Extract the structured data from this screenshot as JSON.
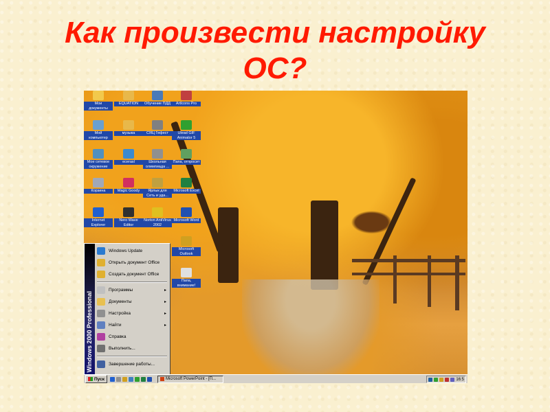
{
  "slide": {
    "title_line1": "Как произвести настройку",
    "title_line2": "ОС?"
  },
  "desktop_icons": [
    {
      "label": "Мои документы",
      "icon": "folder-docs-icon",
      "color": "#f2c94c"
    },
    {
      "label": "EQUATION",
      "icon": "folder-icon",
      "color": "#e8b84a"
    },
    {
      "label": "Обучение ПДД",
      "icon": "car-icon",
      "color": "#4a7ab8"
    },
    {
      "label": "ArtIcons Pro",
      "icon": "app-icon",
      "color": "#c04040"
    },
    {
      "label": "Мой компьютер",
      "icon": "computer-icon",
      "color": "#6aa0d0"
    },
    {
      "label": "музыка",
      "icon": "folder-icon",
      "color": "#e8b84a"
    },
    {
      "label": "СЯЦ Гефест",
      "icon": "app-icon",
      "color": "#808080"
    },
    {
      "label": "Ulead GIF Animator 5",
      "icon": "app-icon",
      "color": "#30a030"
    },
    {
      "label": "Мое сетевое окружение",
      "icon": "network-icon",
      "color": "#5090c0"
    },
    {
      "label": "ecerasl",
      "icon": "app-icon",
      "color": "#3a8ad0"
    },
    {
      "label": "Школьная олимпиада ...",
      "icon": "app-icon",
      "color": "#909090"
    },
    {
      "label": "Папа, отпросит",
      "icon": "app-icon",
      "color": "#60a060"
    },
    {
      "label": "Корзина",
      "icon": "recycle-bin-icon",
      "color": "#a0a8b8"
    },
    {
      "label": "Magic Goody",
      "icon": "app-icon",
      "color": "#d03060"
    },
    {
      "label": "Ярлык для Сеть и уда...",
      "icon": "network-icon",
      "color": "#c0a040"
    },
    {
      "label": "Microsoft Excel",
      "icon": "excel-icon",
      "color": "#208040"
    },
    {
      "label": "Internet Explorer",
      "icon": "ie-icon",
      "color": "#2060d0"
    },
    {
      "label": "Nero Wave Editor",
      "icon": "app-icon",
      "color": "#303030"
    },
    {
      "label": "Norton AntiVirus 2002",
      "icon": "app-icon",
      "color": "#e0c020"
    },
    {
      "label": "Microsoft Word",
      "icon": "word-icon",
      "color": "#2050b0"
    },
    {
      "label": "Microsoft Outlook",
      "icon": "outlook-icon",
      "color": "#d0a020"
    },
    {
      "label": "Папа, внимание!",
      "icon": "app-icon",
      "color": "#e0e0e0"
    }
  ],
  "start_menu": {
    "band_text": "Windows 2000 Professional",
    "top_items": [
      {
        "label": "Windows Update",
        "color": "#2a7ad0"
      },
      {
        "label": "Открыть документ Office",
        "color": "#e0b030"
      },
      {
        "label": "Создать документ Office",
        "color": "#e0b030"
      }
    ],
    "items": [
      {
        "label": "Программы",
        "arrow": "▸",
        "color": "#c0c0c0"
      },
      {
        "label": "Документы",
        "arrow": "▸",
        "color": "#e8c050"
      },
      {
        "label": "Настройка",
        "arrow": "▸",
        "color": "#909090"
      },
      {
        "label": "Найти",
        "arrow": "▸",
        "color": "#6080c0"
      },
      {
        "label": "Справка",
        "arrow": "",
        "color": "#b040a0"
      },
      {
        "label": "Выполнить...",
        "arrow": "",
        "color": "#707070"
      }
    ],
    "shutdown": {
      "label": "Завершение работы...",
      "color": "#4060a0"
    }
  },
  "taskbar": {
    "start_label": "Пуск",
    "task_label": "Microsoft PowerPoint - [П...",
    "clock": "16:5"
  }
}
